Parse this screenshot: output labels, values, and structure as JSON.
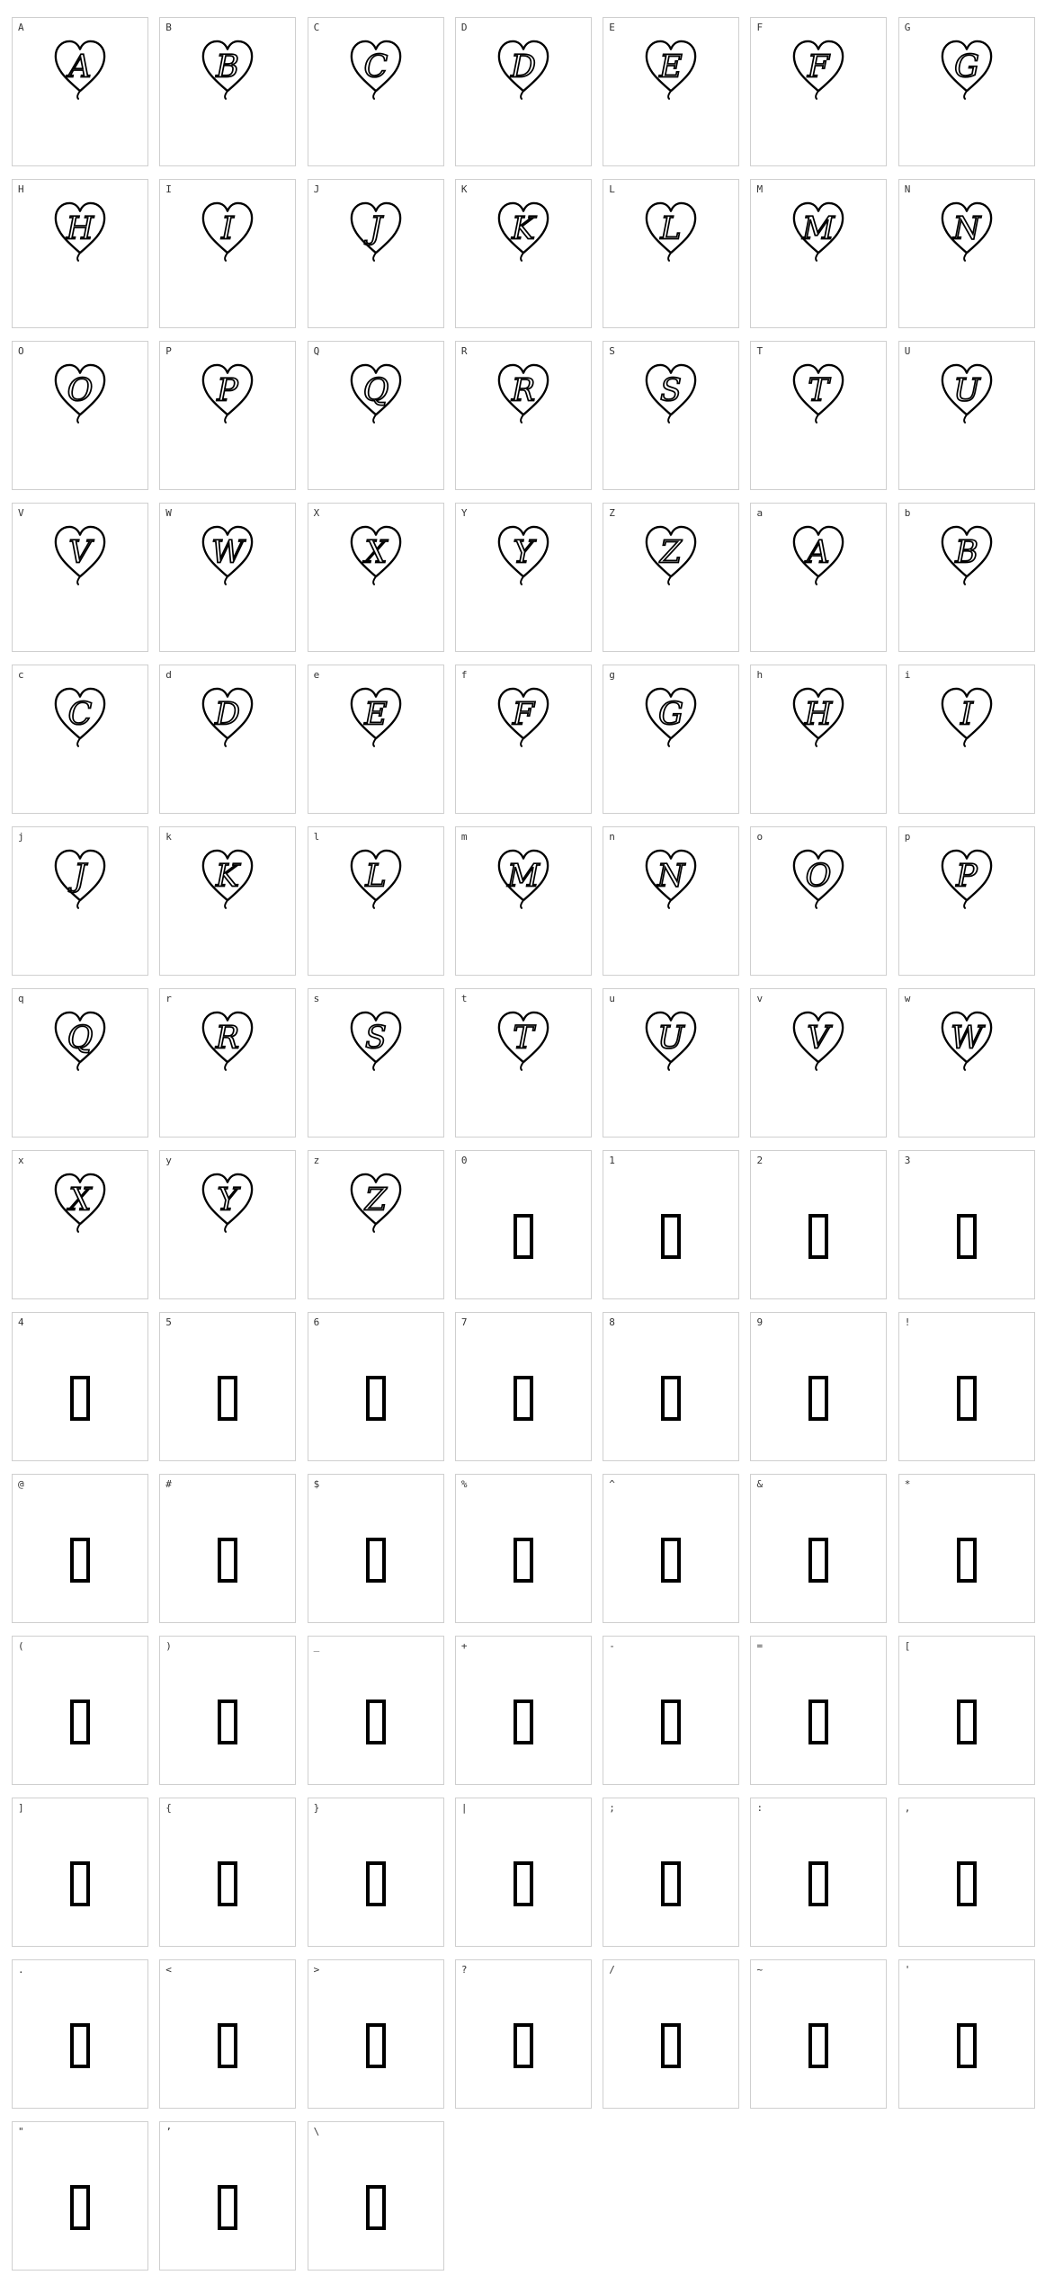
{
  "colors": {
    "background": "#ffffff",
    "cell_border": "#cfcfcf",
    "label": "#333333",
    "ink": "#000000"
  },
  "glyph_icons": {
    "heart_letter": "heart-letter-icon",
    "missing": "missing-glyph-box-icon"
  },
  "cells": [
    {
      "label": "A",
      "glyph": "A"
    },
    {
      "label": "B",
      "glyph": "B"
    },
    {
      "label": "C",
      "glyph": "C"
    },
    {
      "label": "D",
      "glyph": "D"
    },
    {
      "label": "E",
      "glyph": "E"
    },
    {
      "label": "F",
      "glyph": "F"
    },
    {
      "label": "G",
      "glyph": "G"
    },
    {
      "label": "H",
      "glyph": "H"
    },
    {
      "label": "I",
      "glyph": "I"
    },
    {
      "label": "J",
      "glyph": "J"
    },
    {
      "label": "K",
      "glyph": "K"
    },
    {
      "label": "L",
      "glyph": "L"
    },
    {
      "label": "M",
      "glyph": "M"
    },
    {
      "label": "N",
      "glyph": "N"
    },
    {
      "label": "O",
      "glyph": "O"
    },
    {
      "label": "P",
      "glyph": "P"
    },
    {
      "label": "Q",
      "glyph": "Q"
    },
    {
      "label": "R",
      "glyph": "R"
    },
    {
      "label": "S",
      "glyph": "S"
    },
    {
      "label": "T",
      "glyph": "T"
    },
    {
      "label": "U",
      "glyph": "U"
    },
    {
      "label": "V",
      "glyph": "V"
    },
    {
      "label": "W",
      "glyph": "W"
    },
    {
      "label": "X",
      "glyph": "X"
    },
    {
      "label": "Y",
      "glyph": "Y"
    },
    {
      "label": "Z",
      "glyph": "Z"
    },
    {
      "label": "a",
      "glyph": "A"
    },
    {
      "label": "b",
      "glyph": "B"
    },
    {
      "label": "c",
      "glyph": "C"
    },
    {
      "label": "d",
      "glyph": "D"
    },
    {
      "label": "e",
      "glyph": "E"
    },
    {
      "label": "f",
      "glyph": "F"
    },
    {
      "label": "g",
      "glyph": "G"
    },
    {
      "label": "h",
      "glyph": "H"
    },
    {
      "label": "i",
      "glyph": "I"
    },
    {
      "label": "j",
      "glyph": "J"
    },
    {
      "label": "k",
      "glyph": "K"
    },
    {
      "label": "l",
      "glyph": "L"
    },
    {
      "label": "m",
      "glyph": "M"
    },
    {
      "label": "n",
      "glyph": "N"
    },
    {
      "label": "o",
      "glyph": "O"
    },
    {
      "label": "p",
      "glyph": "P"
    },
    {
      "label": "q",
      "glyph": "Q"
    },
    {
      "label": "r",
      "glyph": "R"
    },
    {
      "label": "s",
      "glyph": "S"
    },
    {
      "label": "t",
      "glyph": "T"
    },
    {
      "label": "u",
      "glyph": "U"
    },
    {
      "label": "v",
      "glyph": "V"
    },
    {
      "label": "w",
      "glyph": "W"
    },
    {
      "label": "x",
      "glyph": "X"
    },
    {
      "label": "y",
      "glyph": "Y"
    },
    {
      "label": "z",
      "glyph": "Z"
    },
    {
      "label": "0",
      "glyph": null
    },
    {
      "label": "1",
      "glyph": null
    },
    {
      "label": "2",
      "glyph": null
    },
    {
      "label": "3",
      "glyph": null
    },
    {
      "label": "4",
      "glyph": null
    },
    {
      "label": "5",
      "glyph": null
    },
    {
      "label": "6",
      "glyph": null
    },
    {
      "label": "7",
      "glyph": null
    },
    {
      "label": "8",
      "glyph": null
    },
    {
      "label": "9",
      "glyph": null
    },
    {
      "label": "!",
      "glyph": null
    },
    {
      "label": "@",
      "glyph": null
    },
    {
      "label": "#",
      "glyph": null
    },
    {
      "label": "$",
      "glyph": null
    },
    {
      "label": "%",
      "glyph": null
    },
    {
      "label": "^",
      "glyph": null
    },
    {
      "label": "&",
      "glyph": null
    },
    {
      "label": "*",
      "glyph": null
    },
    {
      "label": "(",
      "glyph": null
    },
    {
      "label": ")",
      "glyph": null
    },
    {
      "label": "_",
      "glyph": null
    },
    {
      "label": "+",
      "glyph": null
    },
    {
      "label": "-",
      "glyph": null
    },
    {
      "label": "=",
      "glyph": null
    },
    {
      "label": "[",
      "glyph": null
    },
    {
      "label": "]",
      "glyph": null
    },
    {
      "label": "{",
      "glyph": null
    },
    {
      "label": "}",
      "glyph": null
    },
    {
      "label": "|",
      "glyph": null
    },
    {
      "label": ";",
      "glyph": null
    },
    {
      "label": ":",
      "glyph": null
    },
    {
      "label": ",",
      "glyph": null
    },
    {
      "label": ".",
      "glyph": null
    },
    {
      "label": "<",
      "glyph": null
    },
    {
      "label": ">",
      "glyph": null
    },
    {
      "label": "?",
      "glyph": null
    },
    {
      "label": "/",
      "glyph": null
    },
    {
      "label": "~",
      "glyph": null
    },
    {
      "label": "'",
      "glyph": null
    },
    {
      "label": "\"",
      "glyph": null
    },
    {
      "label": "’",
      "glyph": null
    },
    {
      "label": "\\",
      "glyph": null
    }
  ]
}
